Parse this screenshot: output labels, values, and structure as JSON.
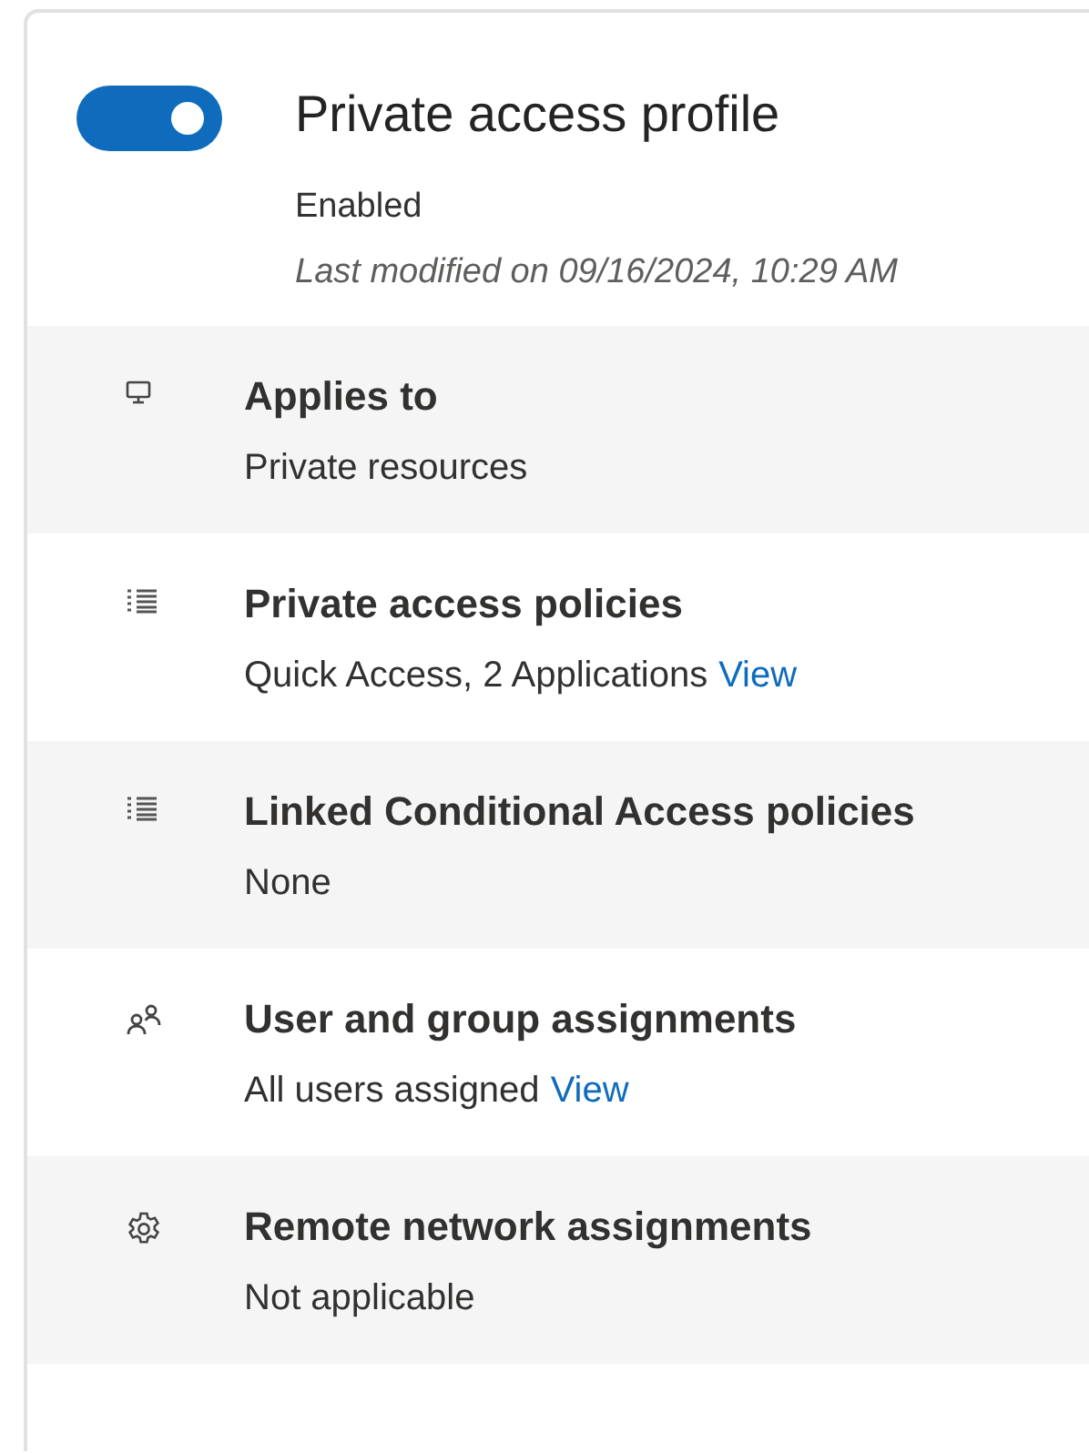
{
  "profile": {
    "enabled": true,
    "title": "Private access profile",
    "status": "Enabled",
    "last_modified": "Last modified on 09/16/2024, 10:29 AM"
  },
  "rows": [
    {
      "kind": "monitor",
      "title": "Applies to",
      "detail": "Private resources"
    },
    {
      "kind": "list",
      "title": "Private access policies",
      "detail": "Quick Access, 2 Applications",
      "link": "View"
    },
    {
      "kind": "list",
      "title": "Linked Conditional Access policies",
      "detail": "None"
    },
    {
      "kind": "people",
      "title": "User and group assignments",
      "detail": "All users assigned",
      "link": "View"
    },
    {
      "kind": "gear",
      "title": "Remote network assignments",
      "detail": "Not applicable"
    }
  ]
}
